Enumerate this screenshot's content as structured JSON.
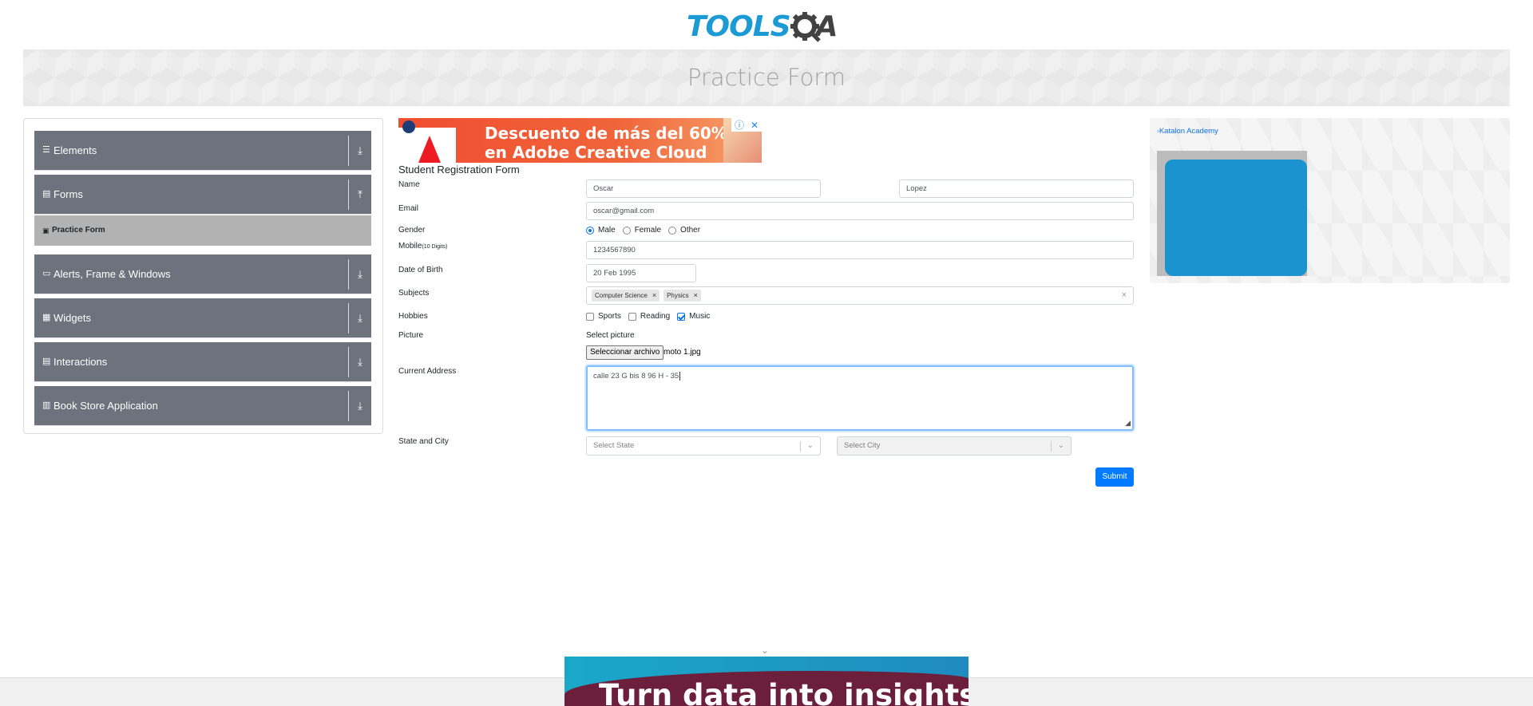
{
  "header": {
    "logo_text": "TOOLS",
    "logo_suffix": "A",
    "page_title": "Practice Form"
  },
  "sidebar": {
    "groups": [
      {
        "label": "Elements",
        "icon": "hamburger-icon",
        "arrow": "download-icon"
      },
      {
        "label": "Forms",
        "icon": "form-icon",
        "arrow": "upload-icon"
      },
      {
        "label": "Alerts, Frame & Windows",
        "icon": "window-icon",
        "arrow": "download-icon"
      },
      {
        "label": "Widgets",
        "icon": "widgets-icon",
        "arrow": "download-icon"
      },
      {
        "label": "Interactions",
        "icon": "interactions-icon",
        "arrow": "download-icon"
      },
      {
        "label": "Book Store Application",
        "icon": "bookstore-icon",
        "arrow": "download-icon"
      }
    ],
    "active_item": "Practice Form"
  },
  "ad_top": {
    "text_line1": "Descuento de más del 60%",
    "text_line2": "en Adobe Creative Cloud"
  },
  "form": {
    "title": "Student Registration Form",
    "labels": {
      "name": "Name",
      "email": "Email",
      "gender": "Gender",
      "mobile": "Mobile",
      "mobile_hint": "(10 Digits)",
      "dob": "Date of Birth",
      "subjects": "Subjects",
      "hobbies": "Hobbies",
      "picture": "Picture",
      "address": "Current Address",
      "state_city": "State and City"
    },
    "first_name": "Oscar",
    "last_name": "Lopez",
    "email": "oscar@gmail.com",
    "gender_options": [
      "Male",
      "Female",
      "Other"
    ],
    "gender_selected": "Male",
    "mobile": "1234567890",
    "dob": "20 Feb 1995",
    "subjects": [
      "Computer Science",
      "Physics"
    ],
    "hobbies": [
      {
        "label": "Sports",
        "checked": false
      },
      {
        "label": "Reading",
        "checked": false
      },
      {
        "label": "Music",
        "checked": true
      }
    ],
    "picture_label": "Select picture",
    "file_button": "Seleccionar archivo",
    "file_name": "moto 1.jpg",
    "address": "calle 23 G bis 8 96 H - 35",
    "state_placeholder": "Select State",
    "city_placeholder": "Select City",
    "submit_label": "Submit"
  },
  "right_ad": {
    "link_text": "Katalon Academy"
  },
  "bottom_ad": {
    "text": "Turn data into insights."
  },
  "colors": {
    "accent": "#007bff",
    "sidebar_group": "#6c737c",
    "logo_blue": "#1b9ad3"
  }
}
